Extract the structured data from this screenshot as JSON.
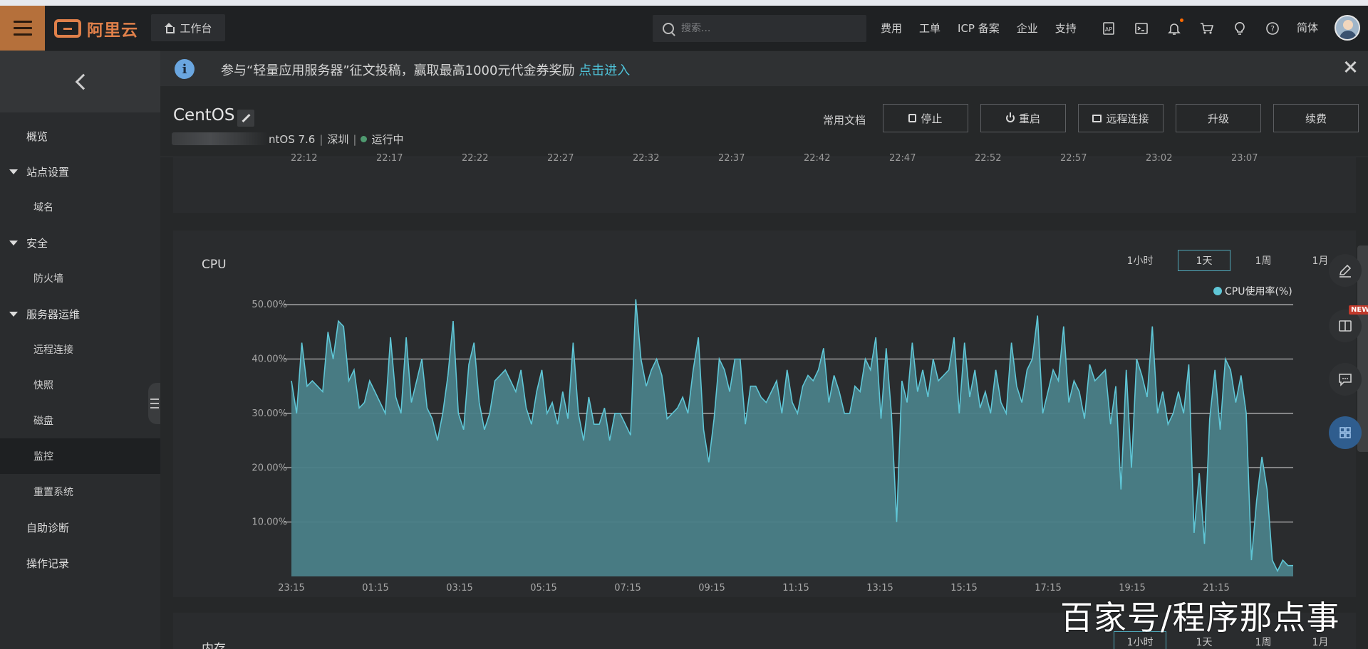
{
  "topbar": {
    "brand": "阿里云",
    "workbench": "工作台",
    "search_placeholder": "搜索...",
    "links": [
      "费用",
      "工单",
      "ICP 备案",
      "企业",
      "支持"
    ],
    "icons": [
      "api-icon",
      "terminal-icon",
      "bell-icon",
      "cart-icon",
      "bulb-icon",
      "help-icon"
    ],
    "language": "简体"
  },
  "sidebar": {
    "items": [
      {
        "label": "概览",
        "kind": "top"
      },
      {
        "label": "站点设置",
        "kind": "group"
      },
      {
        "label": "域名",
        "kind": "sub"
      },
      {
        "label": "安全",
        "kind": "group"
      },
      {
        "label": "防火墙",
        "kind": "sub"
      },
      {
        "label": "服务器运维",
        "kind": "group"
      },
      {
        "label": "远程连接",
        "kind": "sub"
      },
      {
        "label": "快照",
        "kind": "sub"
      },
      {
        "label": "磁盘",
        "kind": "sub"
      },
      {
        "label": "监控",
        "kind": "sub",
        "active": true
      },
      {
        "label": "重置系统",
        "kind": "sub"
      },
      {
        "label": "自助诊断",
        "kind": "top"
      },
      {
        "label": "操作记录",
        "kind": "top"
      }
    ]
  },
  "notice": {
    "text": "参与“轻量应用服务器”征文投稿，赢取最高1000元代金券奖励",
    "link": "点击进入"
  },
  "instance": {
    "name": "CentOS",
    "os": "ntOS 7.6",
    "region": "深圳",
    "status": "运行中",
    "status_color": "#4f9a70"
  },
  "actions": {
    "docs": "常用文档",
    "stop": "停止",
    "restart": "重启",
    "remote": "远程连接",
    "upgrade": "升级",
    "renew": "续费"
  },
  "prev_chart_ticks": [
    "22:12",
    "22:17",
    "22:22",
    "22:27",
    "22:32",
    "22:37",
    "22:42",
    "22:47",
    "22:52",
    "22:57",
    "23:02",
    "23:07"
  ],
  "cpu_card": {
    "title": "CPU",
    "ranges": [
      "1小时",
      "1天",
      "1周",
      "1月"
    ],
    "selected_range": "1天"
  },
  "memory_card": {
    "title": "内存",
    "ranges": [
      "1小时",
      "1天",
      "1周",
      "1月"
    ],
    "selected_range": "1小时"
  },
  "watermark": "百家号/程序那点事",
  "chart_data": {
    "type": "area",
    "title": "CPU",
    "xlabel": "",
    "ylabel": "",
    "x_ticks": [
      "23:15",
      "01:15",
      "03:15",
      "05:15",
      "07:15",
      "09:15",
      "11:15",
      "13:15",
      "15:15",
      "17:15",
      "19:15",
      "21:15"
    ],
    "y_ticks": [
      "10.00%",
      "20.00%",
      "30.00%",
      "40.00%",
      "50.00%"
    ],
    "ylim": [
      0,
      55
    ],
    "grid": true,
    "legend_position": "top-right",
    "series": [
      {
        "name": "CPU使用率(%)",
        "color": "#5fc6d6",
        "values": [
          36,
          30,
          43,
          35,
          36,
          35,
          34,
          45,
          40,
          47,
          46,
          36,
          38,
          31,
          32,
          36,
          34,
          32,
          30,
          44,
          33,
          30,
          44,
          32,
          36,
          40,
          31,
          29,
          25,
          30,
          37,
          47,
          30,
          27,
          39,
          43,
          32,
          27,
          30,
          36,
          37,
          38,
          36,
          34,
          38,
          31,
          28,
          34,
          38,
          30,
          32,
          28,
          34,
          29,
          43,
          30,
          25,
          33,
          28,
          28,
          31,
          25,
          30,
          30,
          28,
          26,
          51,
          40,
          35,
          38,
          40,
          37,
          29,
          30,
          31,
          33,
          30,
          38,
          44,
          27,
          21,
          29,
          40,
          38,
          34,
          40,
          40,
          28,
          35,
          35,
          33,
          32,
          34,
          36,
          30,
          38,
          32,
          30,
          35,
          37,
          36,
          38,
          42,
          32,
          37,
          34,
          30,
          30,
          35,
          34,
          40,
          38,
          44,
          29,
          42,
          30,
          10,
          36,
          32,
          43,
          34,
          38,
          33,
          40,
          36,
          37,
          38,
          44,
          30,
          43,
          33,
          38,
          31,
          34,
          30,
          38,
          32,
          30,
          43,
          35,
          32,
          38,
          40,
          48,
          30,
          34,
          38,
          36,
          46,
          32,
          36,
          34,
          29,
          39,
          36,
          37,
          38,
          28,
          35,
          16,
          38,
          20,
          40,
          37,
          33,
          46,
          30,
          34,
          28,
          30,
          34,
          30,
          39,
          8,
          19,
          6,
          29,
          38,
          27,
          40,
          38,
          32,
          37,
          30,
          3,
          14,
          22,
          16,
          3,
          1,
          3,
          2,
          2
        ]
      }
    ]
  }
}
